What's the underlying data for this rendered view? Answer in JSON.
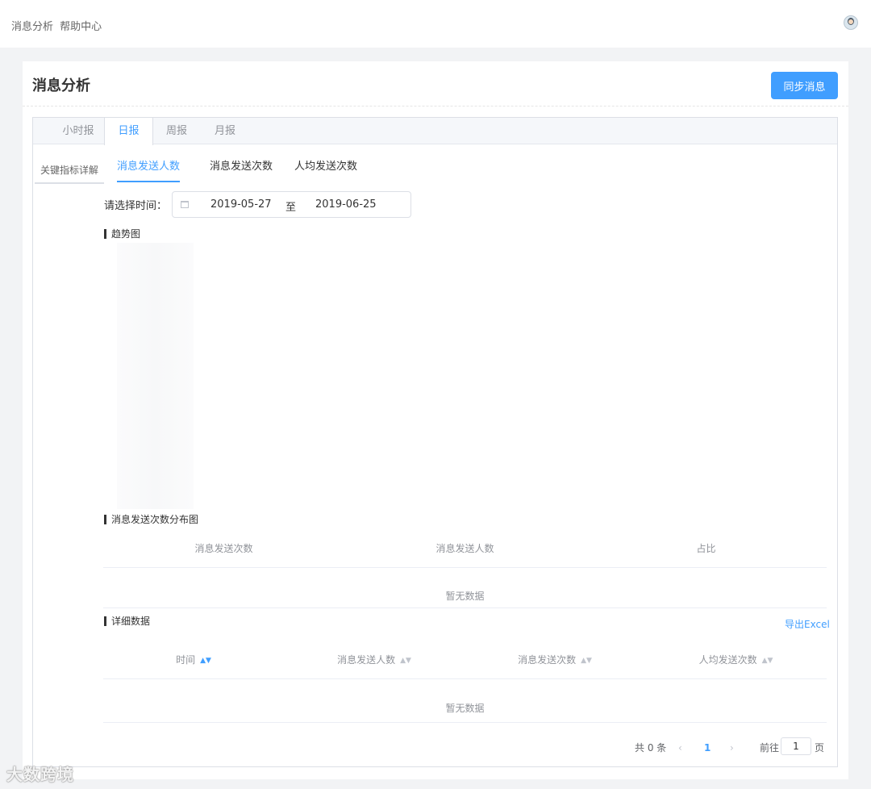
{
  "topbar": {
    "nav": [
      "消息分析",
      "帮助中心"
    ]
  },
  "page": {
    "title": "消息分析",
    "sync_button": "同步消息"
  },
  "tabs": [
    "小时报",
    "日报",
    "周报",
    "月报"
  ],
  "active_tab": "日报",
  "side_tab": "关键指标详解",
  "subtabs": [
    "消息发送人数",
    "消息发送次数",
    "人均发送次数"
  ],
  "date_filter": {
    "label": "请选择时间：",
    "start": "2019-05-27",
    "separator": "至",
    "end": "2019-06-25"
  },
  "trend": {
    "title": "趋势图"
  },
  "distribution": {
    "title": "消息发送次数分布图",
    "columns": [
      "消息发送次数",
      "消息发送人数",
      "占比"
    ],
    "empty": "暂无数据"
  },
  "detail": {
    "title": "详细数据",
    "export": "导出Excel",
    "columns": [
      "时间",
      "消息发送人数",
      "消息发送次数",
      "人均发送次数"
    ],
    "empty": "暂无数据"
  },
  "pagination": {
    "total": "共 0 条",
    "prev": "‹",
    "current": "1",
    "next": "›",
    "goto": "前往",
    "page_input": "1",
    "page_unit": "页"
  },
  "colors": {
    "accent": "#409eff",
    "muted": "#909399"
  },
  "watermark": "大数跨境"
}
